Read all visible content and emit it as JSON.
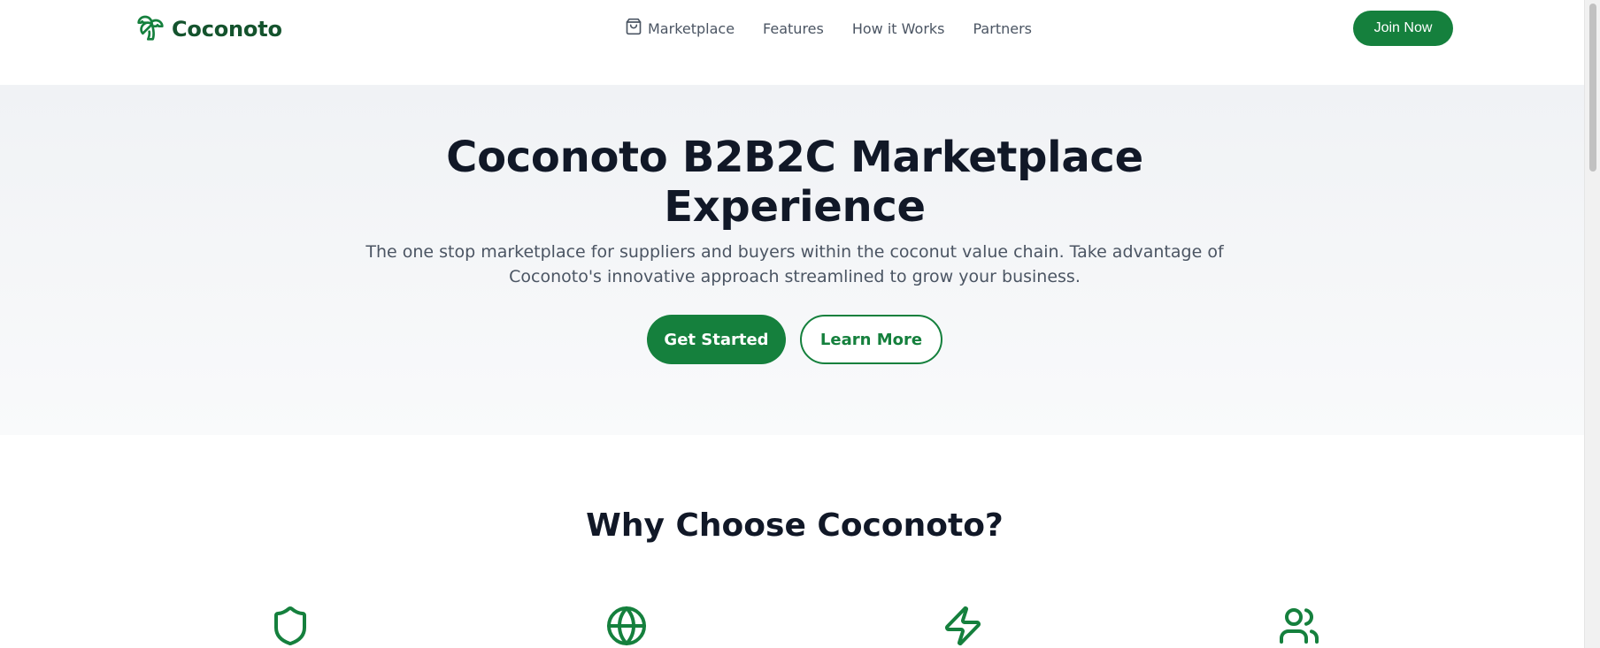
{
  "header": {
    "brand": "Coconoto",
    "nav": [
      {
        "label": "Marketplace",
        "icon": "shopping-bag-icon"
      },
      {
        "label": "Features"
      },
      {
        "label": "How it Works"
      },
      {
        "label": "Partners"
      }
    ],
    "join_label": "Join Now"
  },
  "hero": {
    "title_line1": "Coconoto B2B2C Marketplace",
    "title_line2": "Experience",
    "subtitle_line1": "The one stop marketplace for suppliers and buyers within the coconut value chain. Take advantage of",
    "subtitle_line2": "Coconoto's innovative approach streamlined to grow your business.",
    "primary_cta": "Get Started",
    "secondary_cta": "Learn More"
  },
  "features": {
    "title": "Why Choose Coconoto?",
    "icons": [
      "shield-icon",
      "globe-icon",
      "lightning-icon",
      "users-icon"
    ]
  },
  "colors": {
    "brand_green": "#15803d",
    "brand_dark_green": "#14532d",
    "heading": "#111827",
    "body_text": "#4b5563",
    "hero_bg": "#f3f4f6"
  }
}
